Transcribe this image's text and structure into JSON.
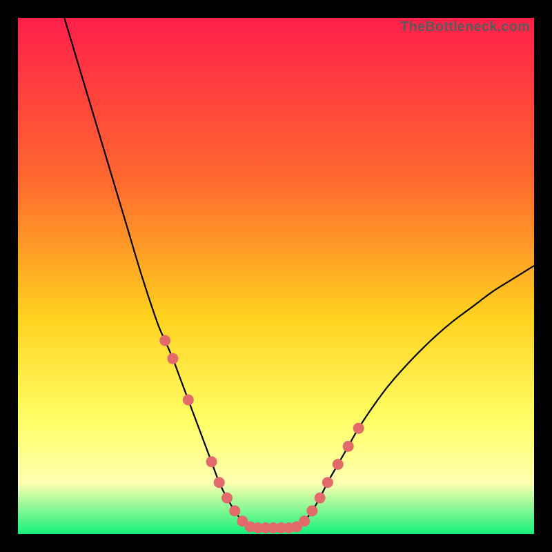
{
  "attribution": "TheBottleneck.com",
  "colors": {
    "gradient_top": "#ff1f4b",
    "gradient_mid1": "#ff6a2e",
    "gradient_mid2": "#ffd21f",
    "gradient_mid3": "#ffff66",
    "gradient_mid4": "#ffffb0",
    "gradient_bottom": "#14f07a",
    "curve": "#000000",
    "marker_fill": "#e26a6a",
    "marker_stroke": "#c95858"
  },
  "chart_data": {
    "type": "line",
    "title": "",
    "xlabel": "",
    "ylabel": "",
    "xlim": [
      0,
      100
    ],
    "ylim": [
      0,
      100
    ],
    "series": [
      {
        "name": "left-branch",
        "x": [
          9,
          12,
          15,
          18,
          21,
          24,
          27,
          28.5,
          30,
          31.5,
          33,
          34.5,
          36,
          37.5,
          39,
          40.5,
          42,
          43.5,
          45
        ],
        "y": [
          100,
          90,
          80,
          70,
          60,
          50,
          41,
          37.5,
          34,
          30,
          26,
          22,
          18,
          14,
          10,
          7,
          4.5,
          2.5,
          1.4
        ]
      },
      {
        "name": "valley-floor",
        "x": [
          45,
          46.5,
          48,
          49.5,
          51,
          52.5,
          54
        ],
        "y": [
          1.4,
          1.2,
          1.2,
          1.2,
          1.2,
          1.2,
          1.4
        ]
      },
      {
        "name": "right-branch",
        "x": [
          54,
          55.5,
          57,
          58.5,
          60,
          62,
          64,
          66,
          69,
          72,
          76,
          80,
          84,
          88,
          92,
          96,
          100
        ],
        "y": [
          1.4,
          2.5,
          4.5,
          7,
          10,
          13.5,
          17,
          20.5,
          25,
          29,
          33.5,
          37.5,
          41,
          44,
          47,
          49.5,
          52
        ]
      }
    ],
    "markers_left": [
      {
        "x": 28.5,
        "y": 37.5
      },
      {
        "x": 30.0,
        "y": 34.0
      },
      {
        "x": 33.0,
        "y": 26.0
      },
      {
        "x": 37.5,
        "y": 14.0
      },
      {
        "x": 39.0,
        "y": 10.0
      },
      {
        "x": 40.5,
        "y": 7.0
      },
      {
        "x": 42.0,
        "y": 4.5
      },
      {
        "x": 43.5,
        "y": 2.5
      }
    ],
    "markers_right": [
      {
        "x": 55.5,
        "y": 2.5
      },
      {
        "x": 57.0,
        "y": 4.5
      },
      {
        "x": 58.5,
        "y": 7.0
      },
      {
        "x": 60.0,
        "y": 10.0
      },
      {
        "x": 62.0,
        "y": 13.5
      },
      {
        "x": 64.0,
        "y": 17.0
      },
      {
        "x": 66.0,
        "y": 20.5
      }
    ],
    "markers_floor": [
      {
        "x": 45.0,
        "y": 1.4
      },
      {
        "x": 46.5,
        "y": 1.2
      },
      {
        "x": 48.0,
        "y": 1.2
      },
      {
        "x": 49.5,
        "y": 1.2
      },
      {
        "x": 51.0,
        "y": 1.2
      },
      {
        "x": 52.5,
        "y": 1.2
      },
      {
        "x": 54.0,
        "y": 1.4
      }
    ]
  }
}
